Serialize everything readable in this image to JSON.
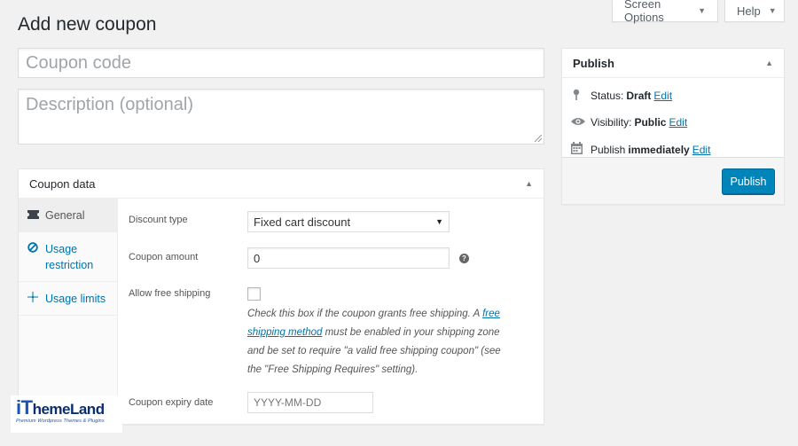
{
  "top_buttons": {
    "screen_options": "Screen Options",
    "help": "Help"
  },
  "page_title": "Add new coupon",
  "coupon_code": {
    "placeholder": "Coupon code"
  },
  "description": {
    "placeholder": "Description (optional)"
  },
  "coupon_data": {
    "title": "Coupon data",
    "tabs": [
      {
        "label": "General",
        "icon": "ticket-icon"
      },
      {
        "label": "Usage restriction",
        "icon": "block-icon"
      },
      {
        "label": "Usage limits",
        "icon": "limits-icon"
      }
    ],
    "fields": {
      "discount_type_label": "Discount type",
      "discount_type_value": "Fixed cart discount",
      "coupon_amount_label": "Coupon amount",
      "coupon_amount_value": "0",
      "free_shipping_label": "Allow free shipping",
      "free_shipping_desc_1": "Check this box if the coupon grants free shipping. A ",
      "free_shipping_link": "free shipping method",
      "free_shipping_desc_2": " must be enabled in your shipping zone and be set to require \"a valid free shipping coupon\" (see the \"Free Shipping Requires\" setting).",
      "expiry_label": "Coupon expiry date",
      "expiry_placeholder": "YYYY-MM-DD"
    }
  },
  "publish": {
    "title": "Publish",
    "status_label": "Status:",
    "status_value": "Draft",
    "visibility_label": "Visibility:",
    "visibility_value": "Public",
    "publish_label": "Publish",
    "publish_value": "immediately",
    "edit": "Edit",
    "button": "Publish"
  },
  "logo": {
    "main_i": "iT",
    "main_rest": "hemeLand",
    "tagline": "Premium Wordpress Themes & Plugins"
  },
  "colors": {
    "accent": "#0085ba",
    "link": "#0073aa"
  }
}
